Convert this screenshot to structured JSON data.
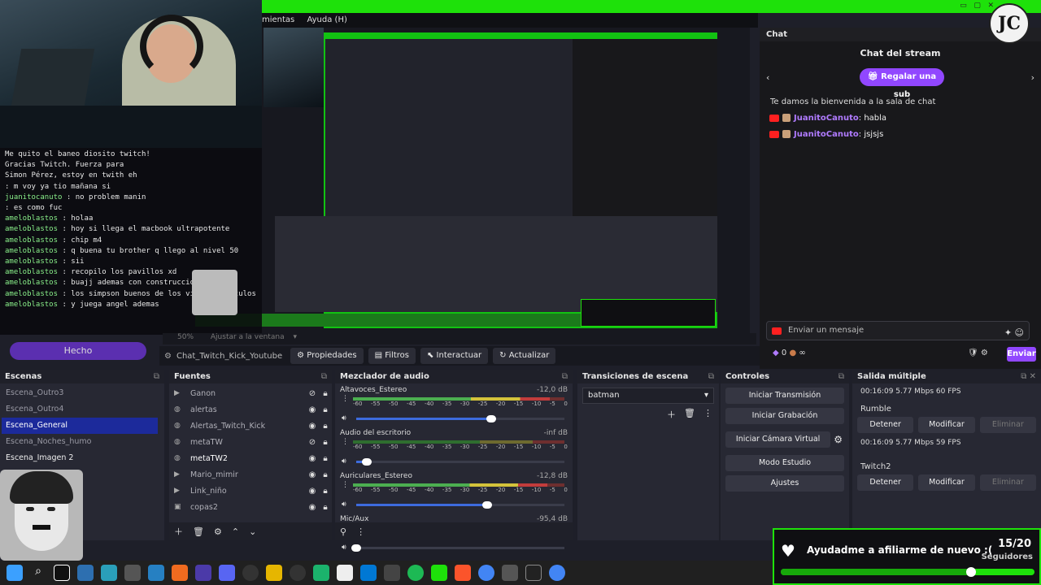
{
  "menu": {
    "items": [
      "mientas",
      "Ayuda (H)"
    ]
  },
  "overlay_chat": {
    "lines": [
      {
        "user": "",
        "text": "Me quito el baneo diosito twitch!"
      },
      {
        "user": "",
        "text": "Gracias Twitch. Fuerza para"
      },
      {
        "user": "",
        "text": "Simon Pérez, estoy en twith eh"
      },
      {
        "user": "",
        "text": ": m voy ya tio mañana si"
      },
      {
        "user": "juanitocanuto",
        "text": ": no problem manin"
      },
      {
        "user": "",
        "text": ": es como fuc"
      },
      {
        "user": "ameloblastos",
        "text": ": holaa"
      },
      {
        "user": "ameloblastos",
        "text": ": hoy si llega el macbook ultrapotente"
      },
      {
        "user": "ameloblastos",
        "text": ": chip m4"
      },
      {
        "user": "ameloblastos",
        "text": ": q buena tu brother q llego al nivel 50"
      },
      {
        "user": "ameloblastos",
        "text": ": sii"
      },
      {
        "user": "ameloblastos",
        "text": ": recopilo los pavillos xd"
      },
      {
        "user": "ameloblastos",
        "text": ": buajj ademas con construccion"
      },
      {
        "user": "ameloblastos",
        "text": ": los simpson buenos de los viejos capitulos"
      },
      {
        "user": "ameloblastos",
        "text": ": y juega angel ademas"
      }
    ],
    "hecho": "Hecho"
  },
  "zoom": {
    "label": "50%",
    "adjust": "Ajustar a la ventana"
  },
  "toolbar": {
    "source_name": "Chat_Twitch_Kick_Youtube",
    "properties": "Propiedades",
    "filters": "Filtros",
    "interact": "Interactuar",
    "refresh": "Actualizar"
  },
  "scenes": {
    "title": "Escenas",
    "items": [
      "Escena_Outro3",
      "Escena_Outro4",
      "Escena_General",
      "Escena_Noches_humo",
      "Escena_Imagen 2"
    ],
    "selected_index": 2
  },
  "sources": {
    "title": "Fuentes",
    "items": [
      "Ganon",
      "alertas",
      "Alertas_Twitch_Kick",
      "metaTW",
      "metaTW2",
      "Mario_mimir",
      "Link_niño",
      "copas2"
    ]
  },
  "mixer": {
    "title": "Mezclador de audio",
    "channels": [
      {
        "name": "Altavoces_Estereo",
        "db": "-12,0 dB",
        "level": 0.93,
        "volume": 0.65
      },
      {
        "name": "Audio del escritorio",
        "db": "-inf dB",
        "level": 0.0,
        "volume": 0.05
      },
      {
        "name": "Auriculares_Estereo",
        "db": "-12,8 dB",
        "level": 0.92,
        "volume": 0.63
      },
      {
        "name": "Mic/Aux",
        "db": "-95,4 dB",
        "level": 0.0,
        "volume": 0.0
      }
    ],
    "ticks": [
      "-60",
      "-55",
      "-50",
      "-45",
      "-40",
      "-35",
      "-30",
      "-25",
      "-20",
      "-15",
      "-10",
      "-5",
      "0"
    ]
  },
  "transitions": {
    "title": "Transiciones de escena",
    "selected": "batman"
  },
  "controls": {
    "title": "Controles",
    "start_stream": "Iniciar Transmisión",
    "start_record": "Iniciar Grabación",
    "virtual_cam": "Iniciar Cámara Virtual",
    "studio_mode": "Modo Estudio",
    "settings": "Ajustes"
  },
  "multi_output": {
    "title": "Salida múltiple",
    "outputs": [
      {
        "name": "",
        "info": "00:16:09  5.77 Mbps  60 FPS"
      },
      {
        "name": "Rumble",
        "info": "00:16:09  5.77 Mbps  59 FPS"
      },
      {
        "name": "Twitch2",
        "info": ""
      }
    ],
    "stop": "Detener",
    "modify": "Modificar",
    "remove": "Eliminar"
  },
  "chat": {
    "tab": "Chat",
    "title": "Chat del stream",
    "sub_button": "Regalar una sub",
    "welcome": "Te damos la bienvenida a la sala de chat",
    "messages": [
      {
        "user": "JuanitoCanuto",
        "text": ": habla"
      },
      {
        "user": "JuanitoCanuto",
        "text": ": jsjsjs"
      }
    ],
    "input_placeholder": "Enviar un mensaje",
    "points": "0",
    "infinity": "∞",
    "send": "Enviar"
  },
  "goal": {
    "title": "Ayudadme a afiliarme de nuevo :(",
    "count": "15/20",
    "label": "Seguidores",
    "progress": 0.75
  },
  "colors": {
    "green": "#1ee10a",
    "purple": "#9147ff",
    "selected_scene": "#1c2a9b"
  }
}
